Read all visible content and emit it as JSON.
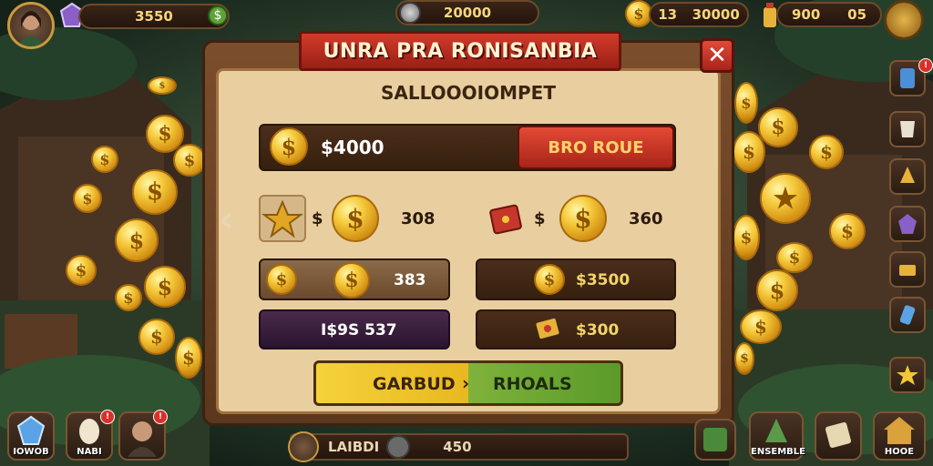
{
  "hud": {
    "player_value": "3550",
    "center_value": "20000",
    "right_a_value": "13",
    "right_b_value": "30000",
    "right_c_value": "900",
    "right_d_value": "05"
  },
  "dialog": {
    "title": "UNRA PRA RONISANBIA",
    "close_label": "✕",
    "subtitle": "SALLOOOIOMPET",
    "top_row": {
      "amount": "$4000",
      "button_label": "BRO ROUE"
    },
    "offer_left": {
      "multiplier": "$",
      "value": "308"
    },
    "offer_right": {
      "multiplier": "$",
      "value": "360"
    },
    "mid_left_value": "383",
    "mid_right_value": "$3500",
    "low_left_value": "I$9S 537",
    "low_right_value": "$300",
    "main_button": {
      "left_label": "GARBUD",
      "right_label": "RHOALS"
    },
    "prev_arrow": "‹"
  },
  "bottom": {
    "left_btn_1": "IOWOB",
    "left_btn_2": "NABI",
    "center_label": "LAIBDI",
    "center_value": "450",
    "right_btn_1": "ENSEMBLE",
    "right_btn_2": "HOOE",
    "badge_1": "!",
    "badge_2": "!"
  },
  "icons": {
    "avatar": "player-avatar-icon",
    "gem": "purple-gem-icon",
    "coin": "gold-coin-icon",
    "chest": "treasure-icon"
  }
}
